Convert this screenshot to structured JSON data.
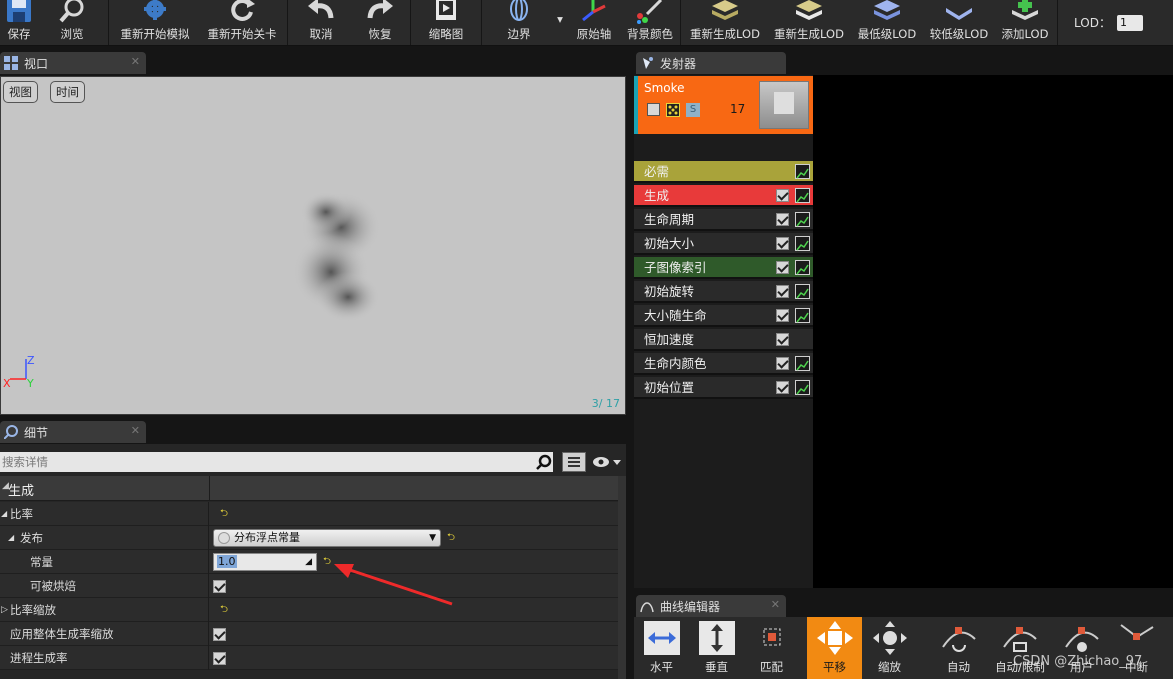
{
  "toolbar": {
    "save": "保存",
    "browse": "浏览",
    "restart_sim": "重新开始模拟",
    "restart_level": "重新开始关卡",
    "undo": "取消",
    "redo": "恢复",
    "thumbnail": "缩略图",
    "bounds": "边界",
    "origin_axis": "原始轴",
    "bg_color": "背景颜色",
    "regen_lod_1": "重新生成LOD",
    "regen_lod_2": "重新生成LOD",
    "lowest_lod": "最低级LOD",
    "lower_lod": "较低级LOD",
    "add_lod": "添加LOD",
    "lod_label": "LOD：",
    "lod_value": "1"
  },
  "viewport": {
    "tab_title": "视口",
    "view_btn": "视图",
    "time_btn": "时间",
    "axis_z": "Z",
    "axis_x": "X",
    "axis_y": "Y",
    "stats": "3/  17"
  },
  "details": {
    "tab_title": "细节",
    "search_placeholder": "搜索详情",
    "category": "生成",
    "rows": [
      {
        "label": "比率",
        "value_type": "reset"
      },
      {
        "label": "发布",
        "value": "分布浮点常量"
      },
      {
        "label": "常量",
        "value": "1.0"
      },
      {
        "label": "可被烘焙",
        "value_type": "checkbox"
      },
      {
        "label": "比率缩放",
        "value_type": "reset"
      },
      {
        "label": "应用整体生成率缩放",
        "value_type": "checkbox"
      },
      {
        "label": "进程生成率",
        "value_type": "checkbox"
      }
    ]
  },
  "emitters": {
    "tab_title": "发射器",
    "emitter_name": "Smoke",
    "emitter_count": "17",
    "modules": [
      {
        "label": "必需",
        "bg": "#a9a33a"
      },
      {
        "label": "生成",
        "bg": "#e83a3a"
      },
      {
        "label": "生命周期",
        "bg": "#2a2a2a"
      },
      {
        "label": "初始大小",
        "bg": "#2a2a2a"
      },
      {
        "label": "子图像索引",
        "bg": "#2f5a2a"
      },
      {
        "label": "初始旋转",
        "bg": "#2a2a2a"
      },
      {
        "label": "大小随生命",
        "bg": "#2a2a2a"
      },
      {
        "label": "恒加速度",
        "bg": "#2a2a2a"
      },
      {
        "label": "生命内颜色",
        "bg": "#2a2a2a"
      },
      {
        "label": "初始位置",
        "bg": "#2a2a2a"
      }
    ]
  },
  "curve_editor": {
    "tab_title": "曲线编辑器",
    "horizontal": "水平",
    "vertical": "垂直",
    "fit": "匹配",
    "pan": "平移",
    "zoom": "缩放",
    "auto": "自动",
    "auto_clamped": "自动/限制",
    "user": "用户",
    "break": "中断"
  },
  "watermark": "CSDN @Zhichao_97",
  "colors": {
    "accent_orange": "#f28a12",
    "emitter_orange": "#f86813",
    "spawn_red": "#e83a3a",
    "required_yellow": "#a9a33a",
    "reset_yellow": "#e6d33a"
  }
}
